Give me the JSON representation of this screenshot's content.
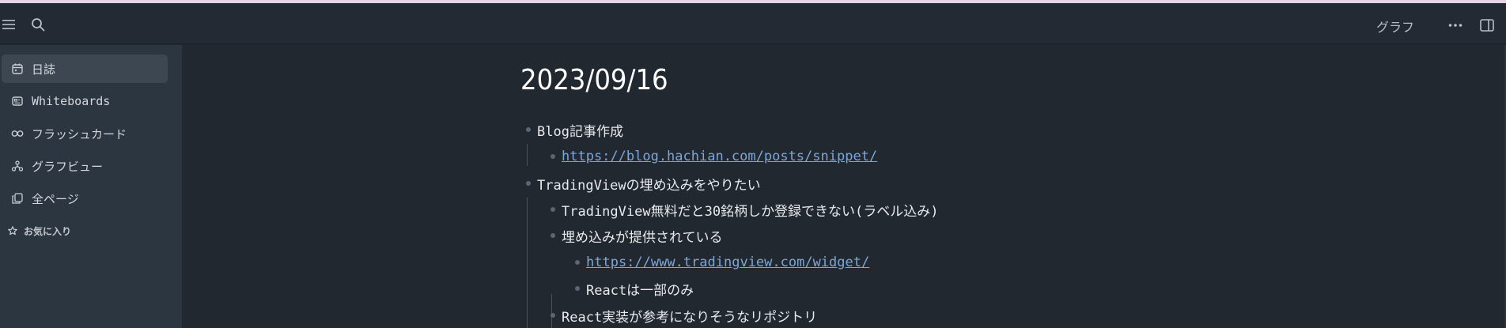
{
  "topbar": {
    "menu_icon": "hamburger-menu-icon",
    "search_icon": "search-icon",
    "graph_label": "グラフ",
    "more_icon": "more-dots-icon",
    "panel_icon": "sidebar-panel-icon"
  },
  "sidebar": {
    "items": [
      {
        "label": "日誌",
        "icon": "calendar-icon",
        "active": true
      },
      {
        "label": "Whiteboards",
        "icon": "whiteboard-icon",
        "active": false
      },
      {
        "label": "フラッシュカード",
        "icon": "infinity-icon",
        "active": false
      },
      {
        "label": "グラフビュー",
        "icon": "graph-icon",
        "active": false
      },
      {
        "label": "全ページ",
        "icon": "pages-icon",
        "active": false
      }
    ],
    "favorites_label": "お気に入り",
    "favorites_icon": "star-icon"
  },
  "page": {
    "title": "2023/09/16",
    "blocks": [
      {
        "text": "Blog記事作成",
        "level": 0,
        "link": false
      },
      {
        "text": "https://blog.hachian.com/posts/snippet/",
        "level": 1,
        "link": true
      },
      {
        "text": "TradingViewの埋め込みをやりたい",
        "level": 0,
        "link": false
      },
      {
        "text": "TradingView無料だと30銘柄しか登録できない(ラベル込み)",
        "level": 1,
        "link": false
      },
      {
        "text": "埋め込みが提供されている",
        "level": 1,
        "link": false
      },
      {
        "text": "https://www.tradingview.com/widget/",
        "level": 2,
        "link": true
      },
      {
        "text": "Reactは一部のみ",
        "level": 2,
        "link": false
      },
      {
        "text": "React実装が参考になりそうなリポジトリ",
        "level": 1,
        "link": false
      }
    ]
  },
  "colors": {
    "background": "#222830",
    "sidebar": "#2c3640",
    "active_item": "#3c4752",
    "link": "#7ba7d8",
    "accent_strip": "#e8d4e6"
  }
}
